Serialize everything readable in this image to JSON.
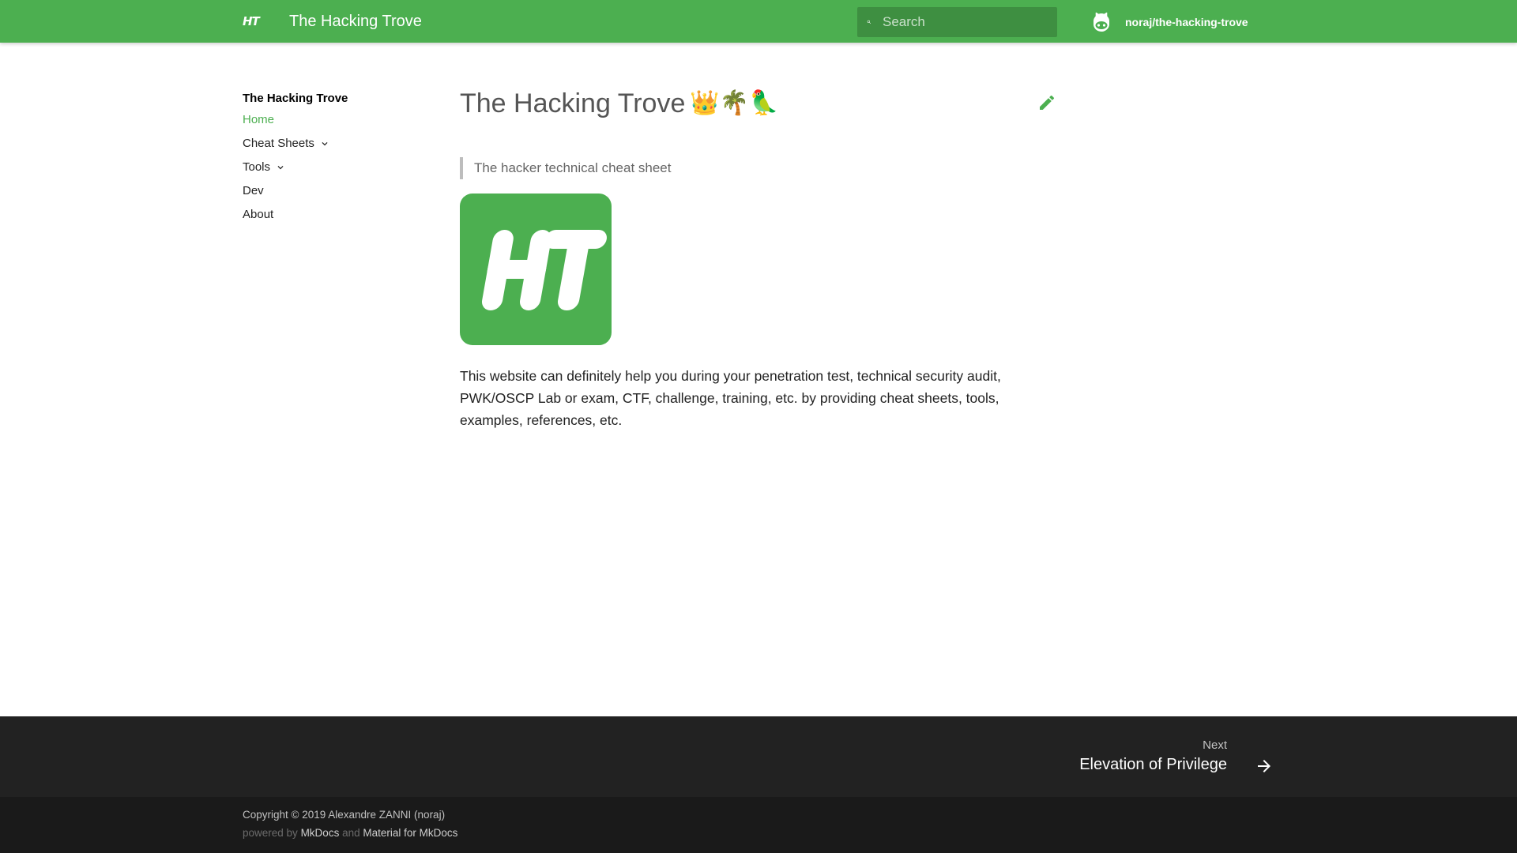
{
  "header": {
    "logo_text": "HT",
    "site_title": "The Hacking Trove",
    "search_placeholder": "Search",
    "repo_name": "noraj/the-hacking-trove"
  },
  "sidebar": {
    "title": "The Hacking Trove",
    "items": [
      {
        "label": "Home",
        "active": true,
        "expandable": false
      },
      {
        "label": "Cheat Sheets",
        "active": false,
        "expandable": true
      },
      {
        "label": "Tools",
        "active": false,
        "expandable": true
      },
      {
        "label": "Dev",
        "active": false,
        "expandable": false
      },
      {
        "label": "About",
        "active": false,
        "expandable": false
      }
    ]
  },
  "content": {
    "title": "The Hacking Trove",
    "title_emoji": "👑🌴🦜",
    "quote": "The hacker technical cheat sheet",
    "logo_text": "HT",
    "paragraph": "This website can definitely help you during your penetration test, technical security audit, PWK/OSCP Lab or exam, CTF, challenge, training, etc. by providing cheat sheets, tools, examples, references, etc."
  },
  "footer": {
    "next_label": "Next",
    "next_title": "Elevation of Privilege",
    "copyright": "Copyright © 2019 Alexandre ZANNI (noraj)",
    "powered_by": "powered by",
    "and_text": "and",
    "mkdocs_link": "MkDocs",
    "material_link": "Material for MkDocs"
  },
  "colors": {
    "primary": "#4caf50",
    "footer_dark": "#222222",
    "footer_darker": "#1a1a1a"
  }
}
